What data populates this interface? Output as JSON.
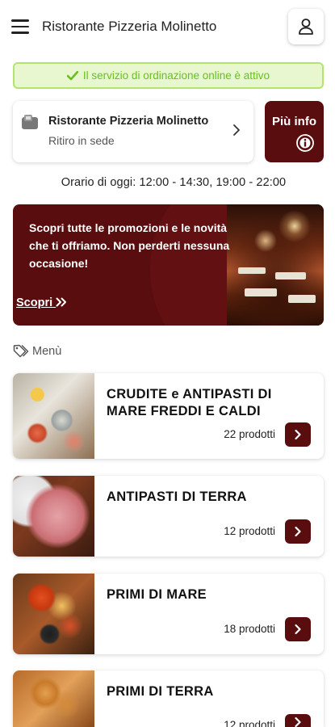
{
  "header": {
    "title": "Ristorante Pizzeria Molinetto"
  },
  "status": {
    "text": "Il servizio di ordinazione online è attivo",
    "color": "#6abf1f"
  },
  "store": {
    "name": "Ristorante Pizzeria Molinetto",
    "mode": "Ritiro in sede"
  },
  "info_button": {
    "label": "Più info"
  },
  "hours": {
    "text": "Orario di oggi: 12:00 - 14:30, 19:00 - 22:00"
  },
  "promo": {
    "text": "Scopri tutte le promozioni e le novità che ti offriamo. Non perderti nessuna occasione!",
    "link": "Scopri"
  },
  "menu": {
    "label": "Menù",
    "categories": [
      {
        "title": "CRUDITE e ANTIPASTI DI MARE FREDDI E CALDI",
        "count": "22 prodotti"
      },
      {
        "title": "ANTIPASTI DI TERRA",
        "count": "12 prodotti"
      },
      {
        "title": "PRIMI DI MARE",
        "count": "18 prodotti"
      },
      {
        "title": "PRIMI DI TERRA",
        "count": "12 prodotti"
      }
    ]
  },
  "theme": {
    "accent": "#5a0d0f",
    "success_bg": "#e8f7d0",
    "success_border": "#b6e36e"
  },
  "icons": [
    "menu-icon",
    "user-icon",
    "check-icon",
    "store-icon",
    "chevron-right-icon",
    "info-icon",
    "double-chevron-right-icon",
    "tag-icon"
  ]
}
